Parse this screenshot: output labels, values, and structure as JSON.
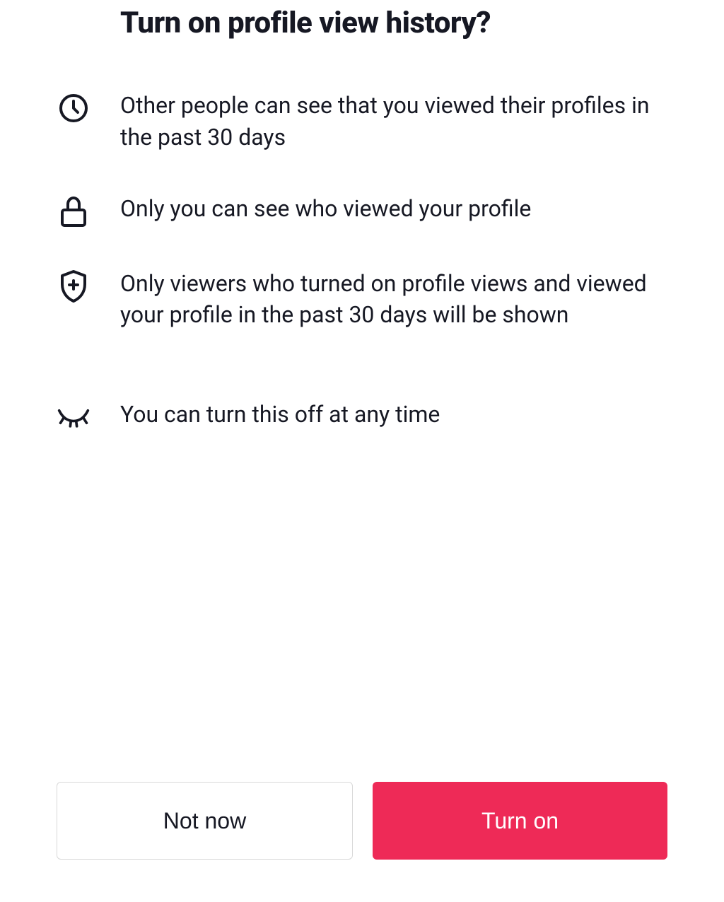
{
  "title": "Turn on profile view history?",
  "items": [
    {
      "icon": "clock-icon",
      "text": "Other people can see that you viewed their profiles in the past 30 days"
    },
    {
      "icon": "lock-icon",
      "text": "Only you can see who viewed your profile"
    },
    {
      "icon": "shield-plus-icon",
      "text": "Only viewers who turned on profile views and viewed your profile in the past 30 days will be shown"
    },
    {
      "icon": "eye-closed-icon",
      "text": "You can turn this off at any time"
    }
  ],
  "buttons": {
    "secondary": "Not now",
    "primary": "Turn on"
  },
  "colors": {
    "primary": "#ee2a57",
    "text": "#161823"
  }
}
